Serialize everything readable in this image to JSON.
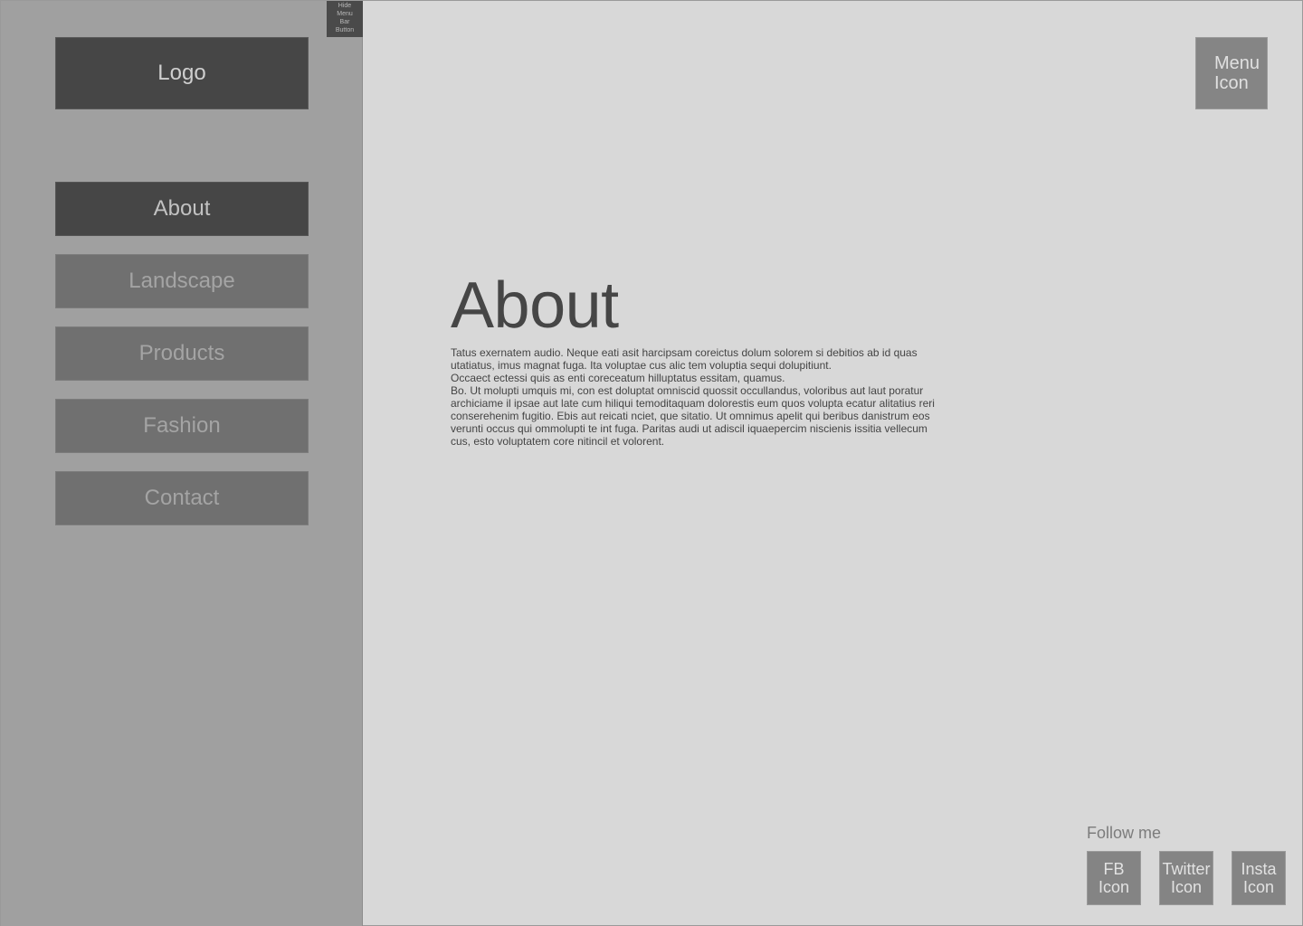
{
  "sidebar": {
    "hide_button": [
      "Hide",
      "Menu",
      "Bar",
      "Button"
    ],
    "logo": "Logo",
    "nav": [
      {
        "label": "About",
        "active": true
      },
      {
        "label": "Landscape",
        "active": false
      },
      {
        "label": "Products",
        "active": false
      },
      {
        "label": "Fashion",
        "active": false
      },
      {
        "label": "Contact",
        "active": false
      }
    ]
  },
  "header": {
    "menu_icon": [
      "Menu",
      "Icon"
    ]
  },
  "main": {
    "title": "About",
    "paragraphs": [
      "Tatus exernatem audio. Neque eati asit harcipsam coreictus dolum solorem si debitios ab id quas utatiatus, imus magnat fuga. Ita voluptae cus alic tem voluptia sequi dolupitiunt.",
      "Occaect ectessi quis as enti coreceatum hilluptatus essitam, quamus.",
      "Bo. Ut molupti umquis mi, con est doluptat omniscid quossit occullandus, voloribus aut laut poratur archiciame il ipsae aut late cum hiliqui temoditaquam dolorestis eum quos volupta ecatur alitatius reri conserehenim fugitio. Ebis aut reicati nciet, que sitatio. Ut omnimus apelit qui beribus danistrum eos verunti occus qui ommolupti te int fuga. Paritas audi ut adiscil iquaepercim niscienis issitia vellecum cus, esto voluptatem core nitincil et volorent."
    ]
  },
  "footer": {
    "follow_label": "Follow me",
    "social": [
      {
        "line1": "FB",
        "line2": "Icon",
        "icon": "facebook-icon"
      },
      {
        "line1": "Twitter",
        "line2": "Icon",
        "icon": "twitter-icon"
      },
      {
        "line1": "Insta",
        "line2": "Icon",
        "icon": "instagram-icon"
      }
    ]
  },
  "colors": {
    "sidebar_bg": "#a0a0a0",
    "content_bg": "#d8d8d8",
    "active_nav_bg": "#464646",
    "inactive_nav_bg": "#707070"
  }
}
